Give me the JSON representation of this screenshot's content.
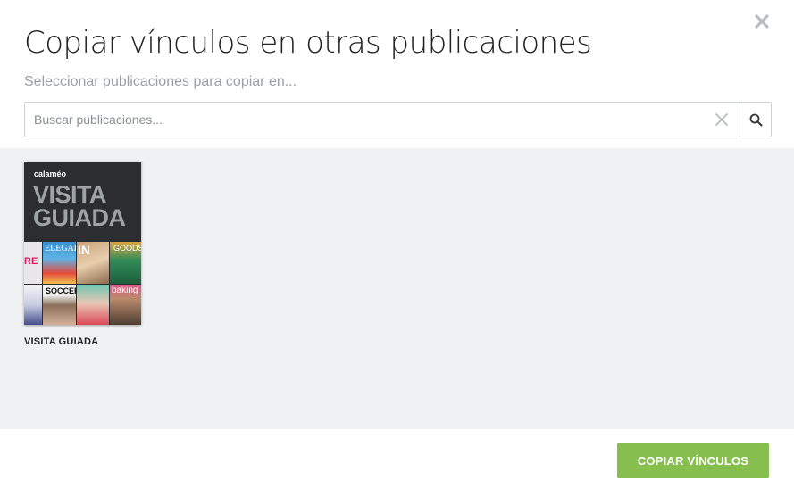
{
  "dialog": {
    "title": "Copiar vínculos en otras publicaciones",
    "subtitle": "Seleccionar publicaciones para copiar en...",
    "close_icon": "close-icon"
  },
  "search": {
    "placeholder": "Buscar publicaciones...",
    "value": "",
    "clear_icon": "clear-icon",
    "search_icon": "search-icon"
  },
  "publications": [
    {
      "label": "VISITA GUIADA",
      "cover": {
        "logo": "calaméo",
        "title_line1": "VISITA",
        "title_line2": "GUIADA",
        "tiles": [
          "RE",
          "ELEGALA",
          "IN",
          "GOODS",
          "",
          "SOCCER",
          "",
          "baking"
        ]
      }
    }
  ],
  "footer": {
    "copy_button": "COPIAR VÍNCULOS"
  },
  "colors": {
    "accent_button": "#86bf4d",
    "content_background": "#f0f1f3",
    "subtitle": "#9a9fa6"
  }
}
